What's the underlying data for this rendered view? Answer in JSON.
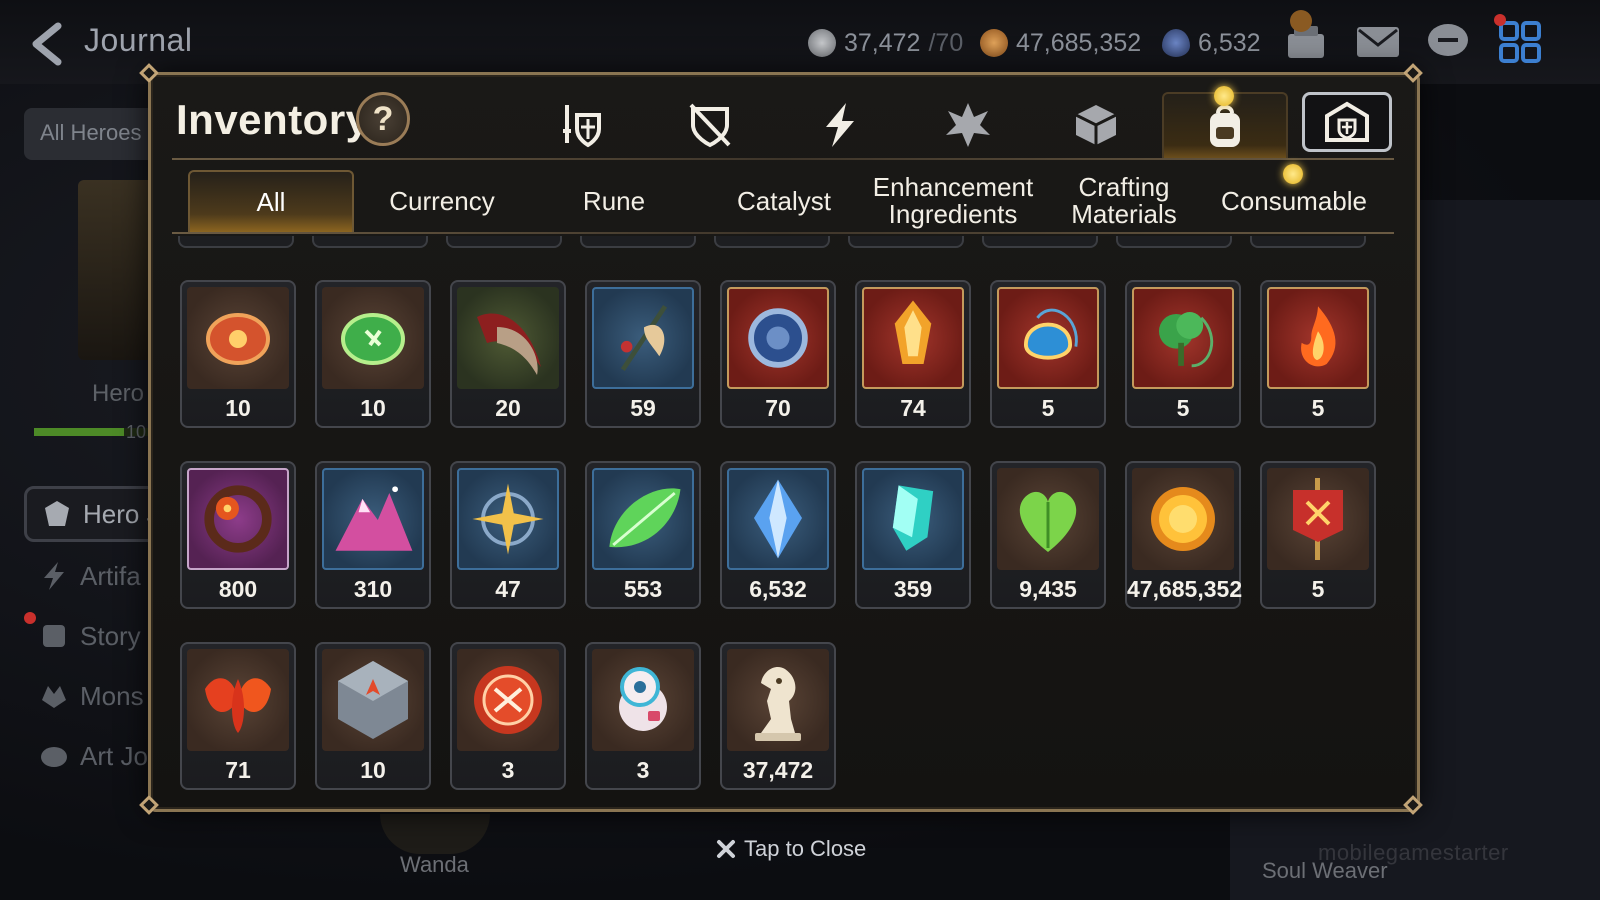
{
  "header": {
    "title": "Journal",
    "resources": [
      {
        "icon": "stamina-icon",
        "value": "37,472",
        "suffix": "/70"
      },
      {
        "icon": "gold-icon",
        "value": "47,685,352"
      },
      {
        "icon": "skystone-icon",
        "value": "6,532"
      }
    ]
  },
  "left": {
    "filter": "All Heroes",
    "hero_label": "Hero",
    "hero_count": "10",
    "menu": [
      {
        "label": "Hero J",
        "icon": "hero-icon"
      },
      {
        "label": "Artifa",
        "icon": "artifact-icon"
      },
      {
        "label": "Story",
        "icon": "story-icon"
      },
      {
        "label": "Mons",
        "icon": "monster-icon"
      },
      {
        "label": "Art Jo",
        "icon": "art-icon"
      }
    ]
  },
  "bottom": {
    "hero_name": "Wanda",
    "right_name": "Soul Weaver",
    "close_label": "Tap to Close",
    "watermark": "mobilegamestarter"
  },
  "inventory": {
    "title": "Inventory",
    "help": "?",
    "categories": [
      "equipment-icon",
      "shield-icon",
      "artifact-bolt-icon",
      "material-icon",
      "box-icon",
      "backpack-icon",
      "storage-icon"
    ],
    "sub_tabs": [
      {
        "label": "All"
      },
      {
        "label": "Currency"
      },
      {
        "label": "Rune"
      },
      {
        "label": "Catalyst"
      },
      {
        "label": "Enhancement Ingredients"
      },
      {
        "label": "Crafting Materials"
      },
      {
        "label": "Consumable"
      }
    ],
    "items": [
      {
        "name": "fire-rune-icon",
        "qty": "10",
        "bg": "brown"
      },
      {
        "name": "earth-rune-icon",
        "qty": "10",
        "bg": "brown"
      },
      {
        "name": "claw-icon",
        "qty": "20",
        "bg": "green"
      },
      {
        "name": "feather-branch-icon",
        "qty": "59",
        "bg": "blue"
      },
      {
        "name": "ice-charm-icon",
        "qty": "70",
        "bg": "red"
      },
      {
        "name": "flame-crystal-icon",
        "qty": "74",
        "bg": "red"
      },
      {
        "name": "ice-amulet-icon",
        "qty": "5",
        "bg": "red"
      },
      {
        "name": "earth-amulet-icon",
        "qty": "5",
        "bg": "red"
      },
      {
        "name": "fire-amulet-icon",
        "qty": "5",
        "bg": "red"
      },
      {
        "name": "flower-charm-icon",
        "qty": "800",
        "bg": "purple"
      },
      {
        "name": "crystal-mountain-icon",
        "qty": "310",
        "bg": "blue"
      },
      {
        "name": "star-compass-icon",
        "qty": "47",
        "bg": "blue"
      },
      {
        "name": "leaf-icon",
        "qty": "553",
        "bg": "blue"
      },
      {
        "name": "skystone-crystal-icon",
        "qty": "6,532",
        "bg": "blue"
      },
      {
        "name": "cyan-crystal-icon",
        "qty": "359",
        "bg": "blue"
      },
      {
        "name": "heart-leaf-icon",
        "qty": "9,435",
        "bg": "brown"
      },
      {
        "name": "gold-coin-icon",
        "qty": "47,685,352",
        "bg": "brown"
      },
      {
        "name": "banner-icon",
        "qty": "5",
        "bg": "brown"
      },
      {
        "name": "red-leaves-icon",
        "qty": "71",
        "bg": "brown"
      },
      {
        "name": "stone-compass-icon",
        "qty": "10",
        "bg": "brown"
      },
      {
        "name": "battle-medal-icon",
        "qty": "3",
        "bg": "brown"
      },
      {
        "name": "pet-doll-icon",
        "qty": "3",
        "bg": "brown"
      },
      {
        "name": "chess-knight-icon",
        "qty": "37,472",
        "bg": "brown"
      }
    ]
  },
  "colors": {
    "accent": "#e3b21f",
    "frame": "#8a7552",
    "gold": "#f2c94c"
  }
}
